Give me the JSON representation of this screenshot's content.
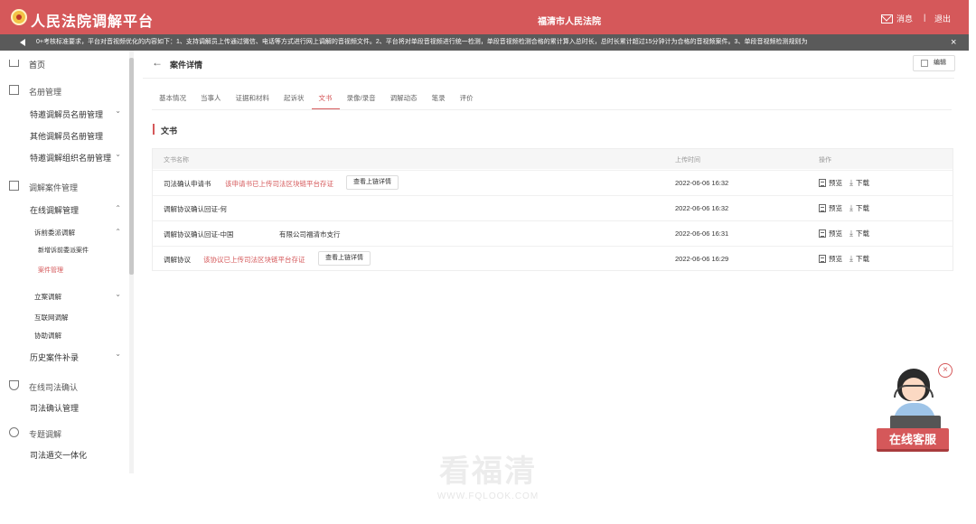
{
  "header": {
    "app_title": "人民法院调解平台",
    "court_name": "福清市人民法院",
    "messages_label": "消息",
    "separator": "|",
    "logout_label": "退出",
    "accent_color": "#d5585a"
  },
  "notice": {
    "text": "0+考核标准要求，平台对音视频优化的内容如下：1、支持调解员上传通过微信、电话等方式进行网上调解的音视频文件。2、平台将对单段音视频进行统一检测，单段音视频检测合格的累计算入总时长，总时长累计超过15分钟计为合格的音视频案件。3、单段音视频检测规则为",
    "close_label": "×"
  },
  "sidebar": {
    "home": "首页",
    "roster_group": "名册管理",
    "invited_mediators": "特邀调解员名册管理",
    "other_mediators": "其他调解员名册管理",
    "invited_orgs": "特邀调解组织名册管理",
    "case_group": "调解案件管理",
    "online_mediation": "在线调解管理",
    "pre_litigation": "诉前委派调解",
    "new_pre_case": "新增诉前委派案件",
    "case_management": "案件管理",
    "filed_mediation": "立案调解",
    "internet_mediation": "互联网调解",
    "assist_mediation": "协助调解",
    "history_cases": "历史案件补录",
    "judicial_group": "在线司法确认",
    "judicial_management": "司法确认管理",
    "special_group": "专题调解",
    "judicial_delivery": "司法遁交一体化",
    "chevron": "⌄",
    "chevron_up": "⌃"
  },
  "main": {
    "back": "←",
    "title": "案件详情",
    "edit_label": "编辑",
    "tabs": [
      "基本情况",
      "当事人",
      "证据和材料",
      "起诉状",
      "文书",
      "录像/录音",
      "调解动态",
      "笔录",
      "评价"
    ],
    "section_title": "文书",
    "table": {
      "col_name": "文书名称",
      "col_time": "上传时间",
      "col_ops": "操作",
      "preview_label": "预览",
      "download_label": "下载",
      "chain_button": "查看上链详情",
      "rows": [
        {
          "name": "司法确认申请书",
          "note": "该申请书已上传司法区块链平台存证",
          "time": "2022-06-06 16:32"
        },
        {
          "name": "调解协议确认回证-何",
          "note": "",
          "time": "2022-06-06 16:32"
        },
        {
          "name": "调解协议确认回证-中国",
          "suffix": "有限公司福清市支行",
          "note": "",
          "time": "2022-06-06 16:31"
        },
        {
          "name": "调解协议",
          "note": "该协议已上传司法区块链平台存证",
          "time": "2022-06-06 16:29"
        }
      ]
    }
  },
  "chat_widget": {
    "label": "在线客服",
    "close_label": "×"
  },
  "watermark": {
    "big": "看福清",
    "small": "WWW.FQLOOK.COM"
  }
}
